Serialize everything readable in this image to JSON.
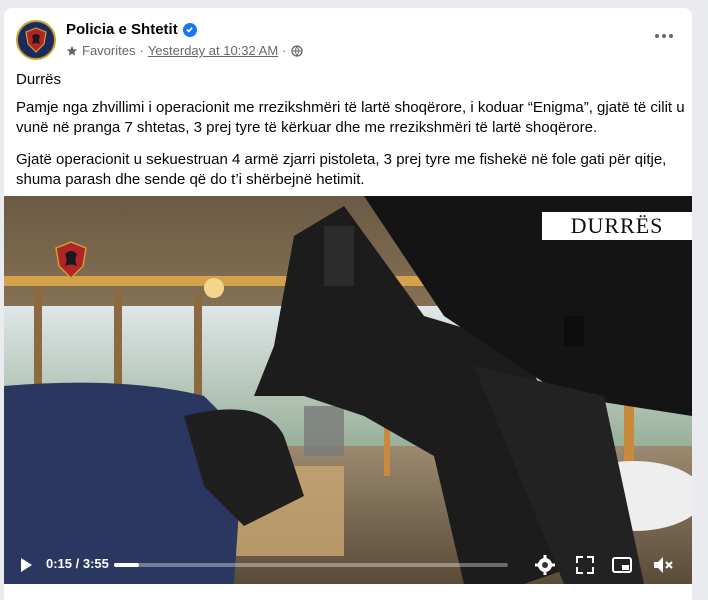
{
  "post": {
    "page_name": "Policia e Shtetit",
    "favorites_label": "Favorites",
    "timestamp": "Yesterday at 10:32 AM",
    "separator": "·",
    "location": "Durrës",
    "paragraph1": "Pamje nga zhvillimi i operacionit me rrezikshmëri të lartë shoqërore, i koduar “Enigma”, gjatë të cilit u vunë në pranga 7 shtetas, 3 prej tyre të kërkuar dhe me rrezikshmëri të lartë shoqërore.",
    "paragraph2": "Gjatë operacionit u sekuestruan 4 armë zjarri pistoleta, 3 prej tyre me fishekë në fole gati për qitje, shuma parash dhe sende që do t’i shërbejnë hetimit."
  },
  "video": {
    "overlay_label": "DURRËS",
    "current_time": "0:15",
    "duration": "3:55",
    "time_separator": " / ",
    "progress_fraction": 0.064
  },
  "colors": {
    "verified": "#1877f2",
    "meta_text": "#65676b",
    "badge_gold": "#c9a12a",
    "badge_red": "#b3242a"
  },
  "icons": [
    "verified-icon",
    "star-icon",
    "globe-icon",
    "more-icon",
    "play-icon",
    "settings-icon",
    "fullscreen-icon",
    "pip-icon",
    "volume-muted-icon"
  ]
}
